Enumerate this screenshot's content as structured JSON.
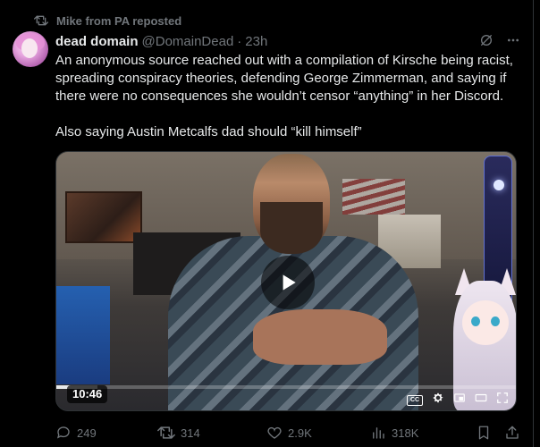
{
  "repost_header": {
    "text": "Mike from PA reposted"
  },
  "author": {
    "display_name": "dead domain",
    "handle": "@DomainDead",
    "separator": "·",
    "time": "23h"
  },
  "tweet": {
    "paragraph_1": "An anonymous source reached out with a compilation of Kirsche being racist, spreading conspiracy theories, defending George Zimmerman, and saying if there were no consequences she wouldn’t censor “anything” in her Discord.",
    "paragraph_2": "Also saying Austin Metcalfs dad should “kill himself”"
  },
  "video": {
    "duration_badge": "10:46",
    "progress": 0.09,
    "icons": [
      "play-icon",
      "closed-captions-icon",
      "settings-gear-icon",
      "picture-in-picture-icon",
      "theater-mode-icon",
      "fullscreen-icon"
    ]
  },
  "actions": {
    "replies": "249",
    "reposts": "314",
    "likes": "2.9K",
    "views": "318K"
  },
  "colors": {
    "background": "#000000",
    "text": "#e7e9ea",
    "muted": "#71767b",
    "border": "#2f3336"
  }
}
